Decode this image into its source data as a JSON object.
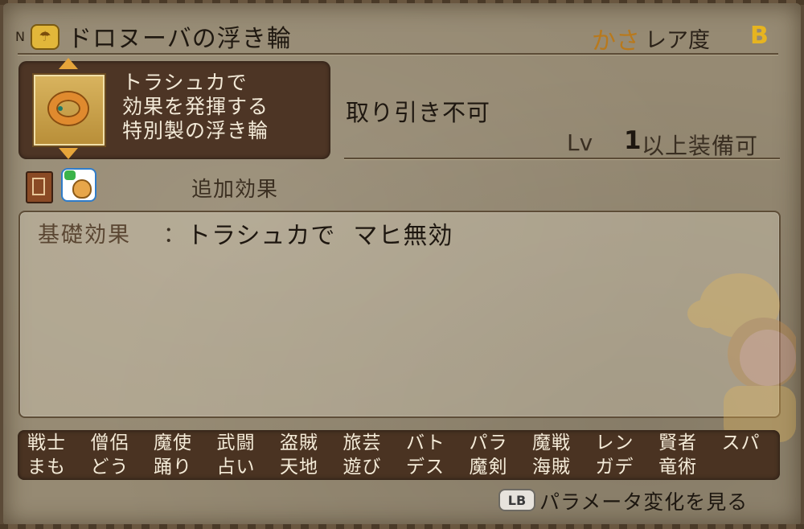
{
  "header": {
    "rank": "N",
    "name": "ドロヌーバの浮き輪",
    "category": "かさ",
    "rarity_label": "レア度",
    "rarity_value": "B"
  },
  "item": {
    "description_lines": [
      "トラシュカで",
      "効果を発揮する",
      "特別製の浮き輪"
    ],
    "trade_status": "取り引き不可",
    "level_label": "Lv",
    "level_value": "1",
    "level_text": "以上装備可",
    "extra_effect_label": "追加効果"
  },
  "effect": {
    "label": "基礎効果",
    "colon": "：",
    "value_part1": "トラシュカで",
    "value_part2": "マヒ無効"
  },
  "jobs": [
    "戦士",
    "僧侶",
    "魔使",
    "武闘",
    "盗賊",
    "旅芸",
    "バト",
    "パラ",
    "魔戦",
    "レン",
    "賢者",
    "スパ",
    "まも",
    "どう",
    "踊り",
    "占い",
    "天地",
    "遊び",
    "デス",
    "魔剣",
    "海賊",
    "ガデ",
    "竜術"
  ],
  "footer": {
    "button_label": "LB",
    "hint": "パラメータ変化を見る"
  },
  "icons": {
    "rank_icon": "umbrella-icon",
    "book": "book-icon",
    "bag": "bag-icon"
  },
  "colors": {
    "category": "#b8791d",
    "rarity": "#e6b420",
    "panel": "#4d3525"
  }
}
